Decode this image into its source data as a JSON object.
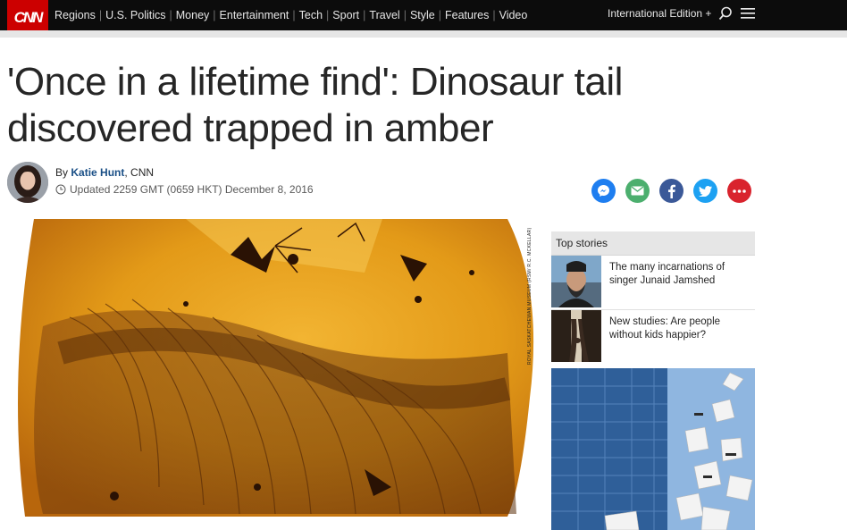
{
  "brand": {
    "logo_text": "CNN",
    "color": "#cc0000"
  },
  "nav": {
    "links": [
      "Regions",
      "U.S. Politics",
      "Money",
      "Entertainment",
      "Tech",
      "Sport",
      "Travel",
      "Style",
      "Features",
      "Video"
    ],
    "edition": "International Edition +",
    "icons": [
      "search-icon",
      "menu-icon"
    ]
  },
  "article": {
    "headline": "'Once in a lifetime find': Dinosaur tail discovered trapped in amber",
    "by_prefix": "By",
    "author": "Katie Hunt",
    "outlet": ", CNN",
    "updated": "Updated 2259 GMT (0659 HKT) December 8, 2016",
    "share_icons": [
      "messenger-icon",
      "email-icon",
      "facebook-icon",
      "twitter-icon",
      "more-icon"
    ],
    "share_colors": [
      "#1e7ef0",
      "#4caf6e",
      "#3b5998",
      "#1da1f2",
      "#d9232d"
    ],
    "image_credit": "ROYAL SASKATCHEWAN MUSEUM (RSM/ R.C. MCKELLAR)"
  },
  "rail": {
    "heading": "Top stories",
    "stories": [
      {
        "title": "The many incarnations of singer Junaid Jamshed"
      },
      {
        "title": "New studies: Are people without kids happier?"
      }
    ]
  }
}
